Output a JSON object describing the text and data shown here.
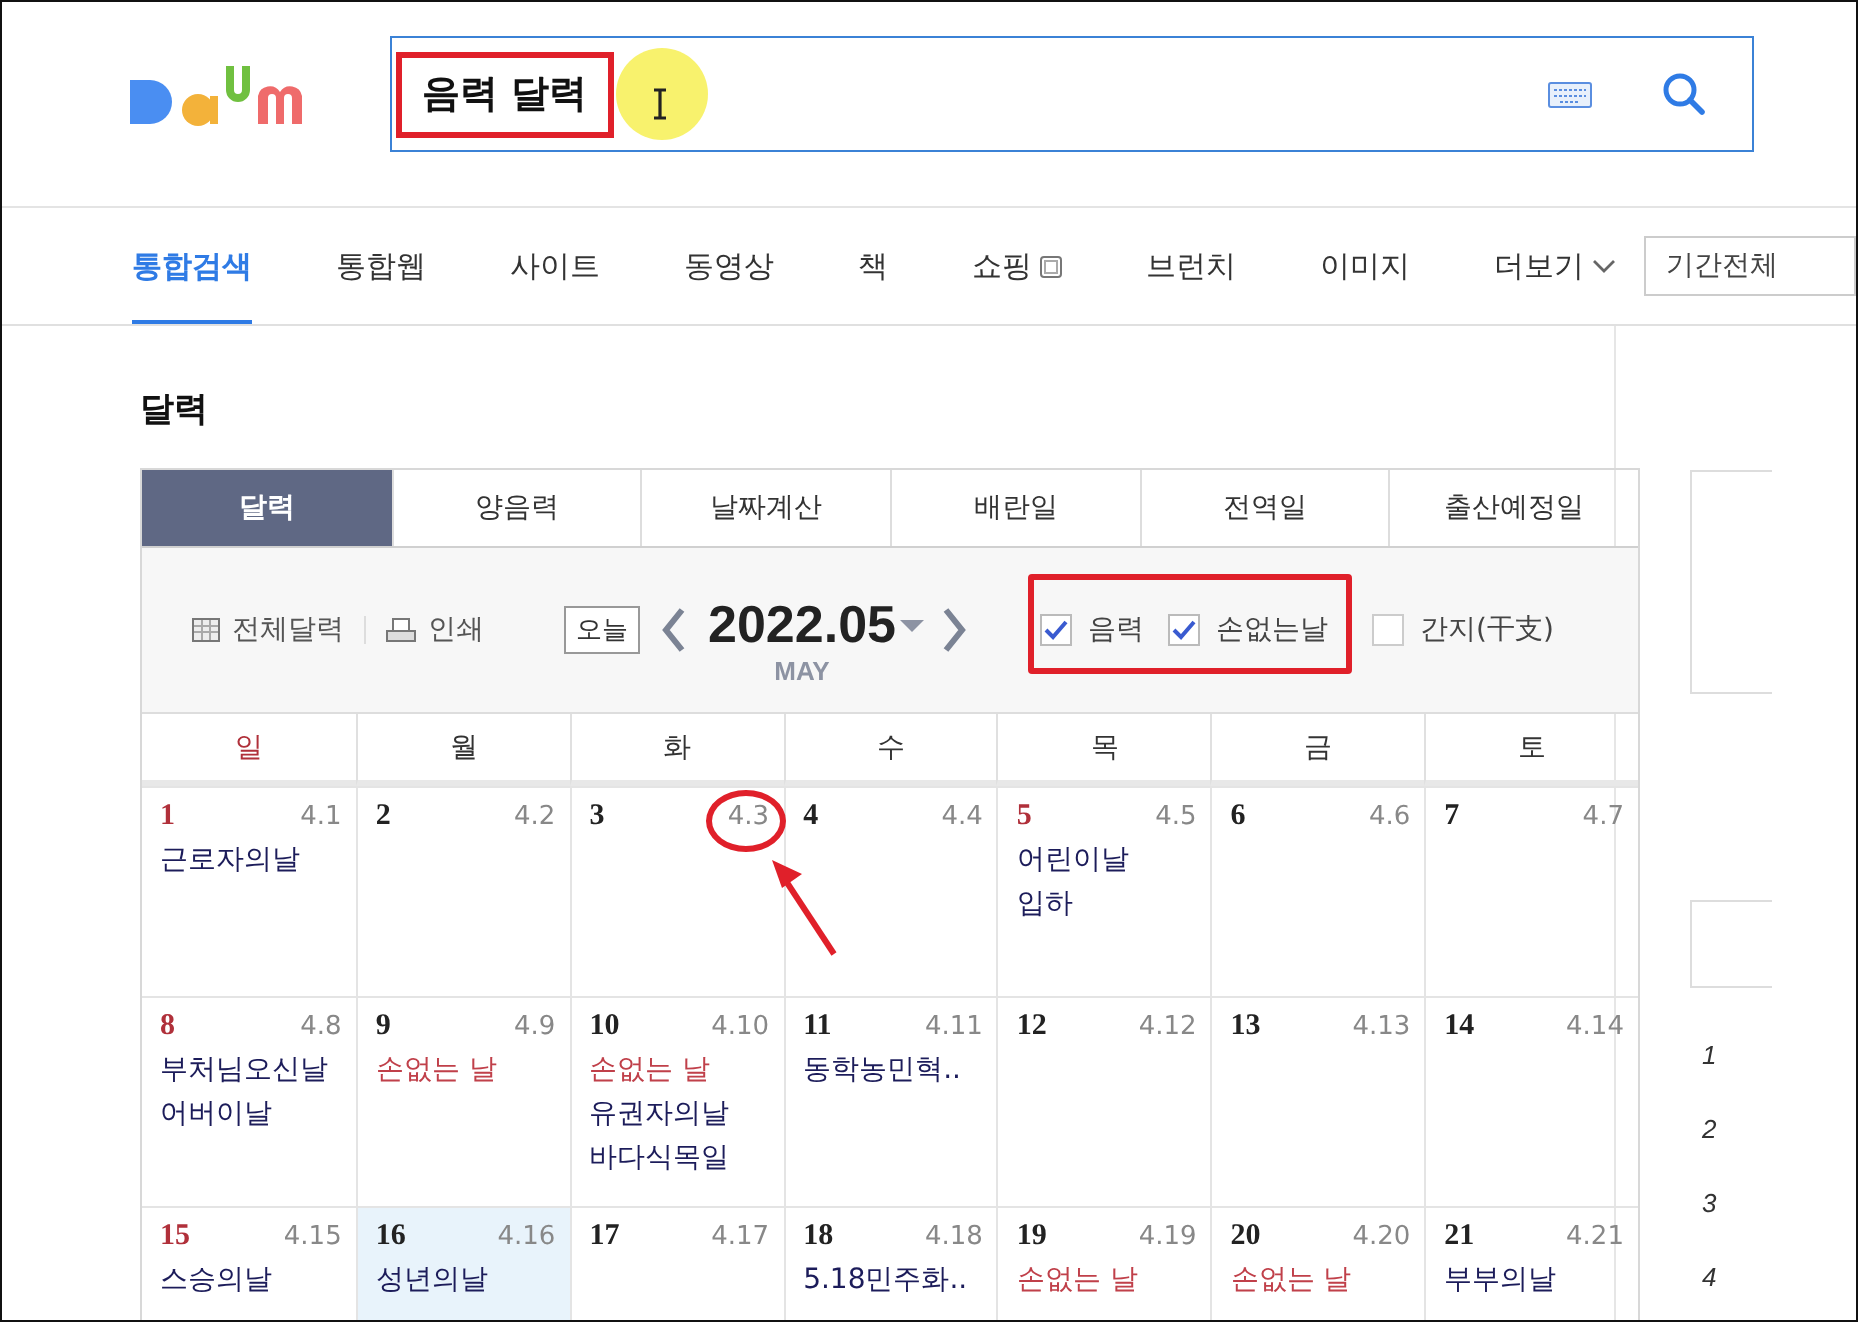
{
  "search": {
    "value": "음력 달력"
  },
  "nav": [
    {
      "label": "통합검색",
      "selected": true
    },
    {
      "label": "통합웹",
      "selected": false
    },
    {
      "label": "사이트",
      "selected": false
    },
    {
      "label": "동영상",
      "selected": false
    },
    {
      "label": "책",
      "selected": false
    },
    {
      "label": "쇼핑",
      "selected": false,
      "kind": "external"
    },
    {
      "label": "브런치",
      "selected": false
    },
    {
      "label": "이미지",
      "selected": false
    },
    {
      "label": "더보기",
      "selected": false,
      "kind": "more"
    }
  ],
  "period_select": {
    "value": "기간전체"
  },
  "section_title": "달력",
  "tabs": [
    {
      "label": "달력",
      "selected": true
    },
    {
      "label": "양음력",
      "selected": false
    },
    {
      "label": "날짜계산",
      "selected": false
    },
    {
      "label": "배란일",
      "selected": false
    },
    {
      "label": "전역일",
      "selected": false
    },
    {
      "label": "출산예정일",
      "selected": false
    }
  ],
  "toolbar": {
    "full_calendar": "전체달력",
    "print": "인쇄",
    "today": "오늘",
    "month": "2022.05",
    "month_name": "MAY"
  },
  "options": [
    {
      "label": "음력",
      "checked": true
    },
    {
      "label": "손없는날",
      "checked": true
    },
    {
      "label": "간지(干支)",
      "checked": false
    }
  ],
  "weekdays": [
    {
      "label": "일",
      "holiday": true
    },
    {
      "label": "월",
      "holiday": false
    },
    {
      "label": "화",
      "holiday": false
    },
    {
      "label": "수",
      "holiday": false
    },
    {
      "label": "목",
      "holiday": false
    },
    {
      "label": "금",
      "holiday": false
    },
    {
      "label": "토",
      "holiday": false
    }
  ],
  "weeks": [
    [
      {
        "day": "1",
        "lunar": "4.1",
        "holiday": true,
        "selected": false,
        "events": [
          {
            "text": "근로자의날",
            "kind": "day"
          }
        ]
      },
      {
        "day": "2",
        "lunar": "4.2",
        "holiday": false,
        "selected": false
      },
      {
        "day": "3",
        "lunar": "4.3",
        "holiday": false,
        "selected": false
      },
      {
        "day": "4",
        "lunar": "4.4",
        "holiday": false,
        "selected": false
      },
      {
        "day": "5",
        "lunar": "4.5",
        "holiday": true,
        "selected": false,
        "events": [
          {
            "text": "어린이날",
            "kind": "day"
          },
          {
            "text": "입하",
            "kind": "day"
          }
        ]
      },
      {
        "day": "6",
        "lunar": "4.6",
        "holiday": false,
        "selected": false
      },
      {
        "day": "7",
        "lunar": "4.7",
        "holiday": false,
        "selected": false
      }
    ],
    [
      {
        "day": "8",
        "lunar": "4.8",
        "holiday": true,
        "selected": false,
        "events": [
          {
            "text": "부처님오신날",
            "kind": "day"
          },
          {
            "text": "어버이날",
            "kind": "day"
          }
        ]
      },
      {
        "day": "9",
        "lunar": "4.9",
        "holiday": false,
        "selected": false,
        "events": [
          {
            "text": "손없는 날",
            "kind": "sonless"
          }
        ]
      },
      {
        "day": "10",
        "lunar": "4.10",
        "holiday": false,
        "selected": false,
        "events": [
          {
            "text": "손없는 날",
            "kind": "sonless"
          },
          {
            "text": "유권자의날",
            "kind": "day"
          },
          {
            "text": "바다식목일",
            "kind": "day"
          }
        ]
      },
      {
        "day": "11",
        "lunar": "4.11",
        "holiday": false,
        "selected": false,
        "events": [
          {
            "text": "동학농민혁..",
            "kind": "day"
          }
        ]
      },
      {
        "day": "12",
        "lunar": "4.12",
        "holiday": false,
        "selected": false
      },
      {
        "day": "13",
        "lunar": "4.13",
        "holiday": false,
        "selected": false
      },
      {
        "day": "14",
        "lunar": "4.14",
        "holiday": false,
        "selected": false
      }
    ],
    [
      {
        "day": "15",
        "lunar": "4.15",
        "holiday": true,
        "selected": false,
        "events": [
          {
            "text": "스승의날",
            "kind": "day"
          }
        ]
      },
      {
        "day": "16",
        "lunar": "4.16",
        "holiday": false,
        "selected": true,
        "events": [
          {
            "text": "성년의날",
            "kind": "day"
          }
        ]
      },
      {
        "day": "17",
        "lunar": "4.17",
        "holiday": false,
        "selected": false
      },
      {
        "day": "18",
        "lunar": "4.18",
        "holiday": false,
        "selected": false,
        "events": [
          {
            "text": "5.18민주화..",
            "kind": "day"
          }
        ]
      },
      {
        "day": "19",
        "lunar": "4.19",
        "holiday": false,
        "selected": false,
        "events": [
          {
            "text": "손없는 날",
            "kind": "sonless"
          }
        ]
      },
      {
        "day": "20",
        "lunar": "4.20",
        "holiday": false,
        "selected": false,
        "events": [
          {
            "text": "손없는 날",
            "kind": "sonless"
          }
        ]
      },
      {
        "day": "21",
        "lunar": "4.21",
        "holiday": false,
        "selected": false,
        "events": [
          {
            "text": "부부의날",
            "kind": "day"
          }
        ]
      }
    ]
  ],
  "side_list": [
    "1",
    "2",
    "3",
    "4"
  ]
}
